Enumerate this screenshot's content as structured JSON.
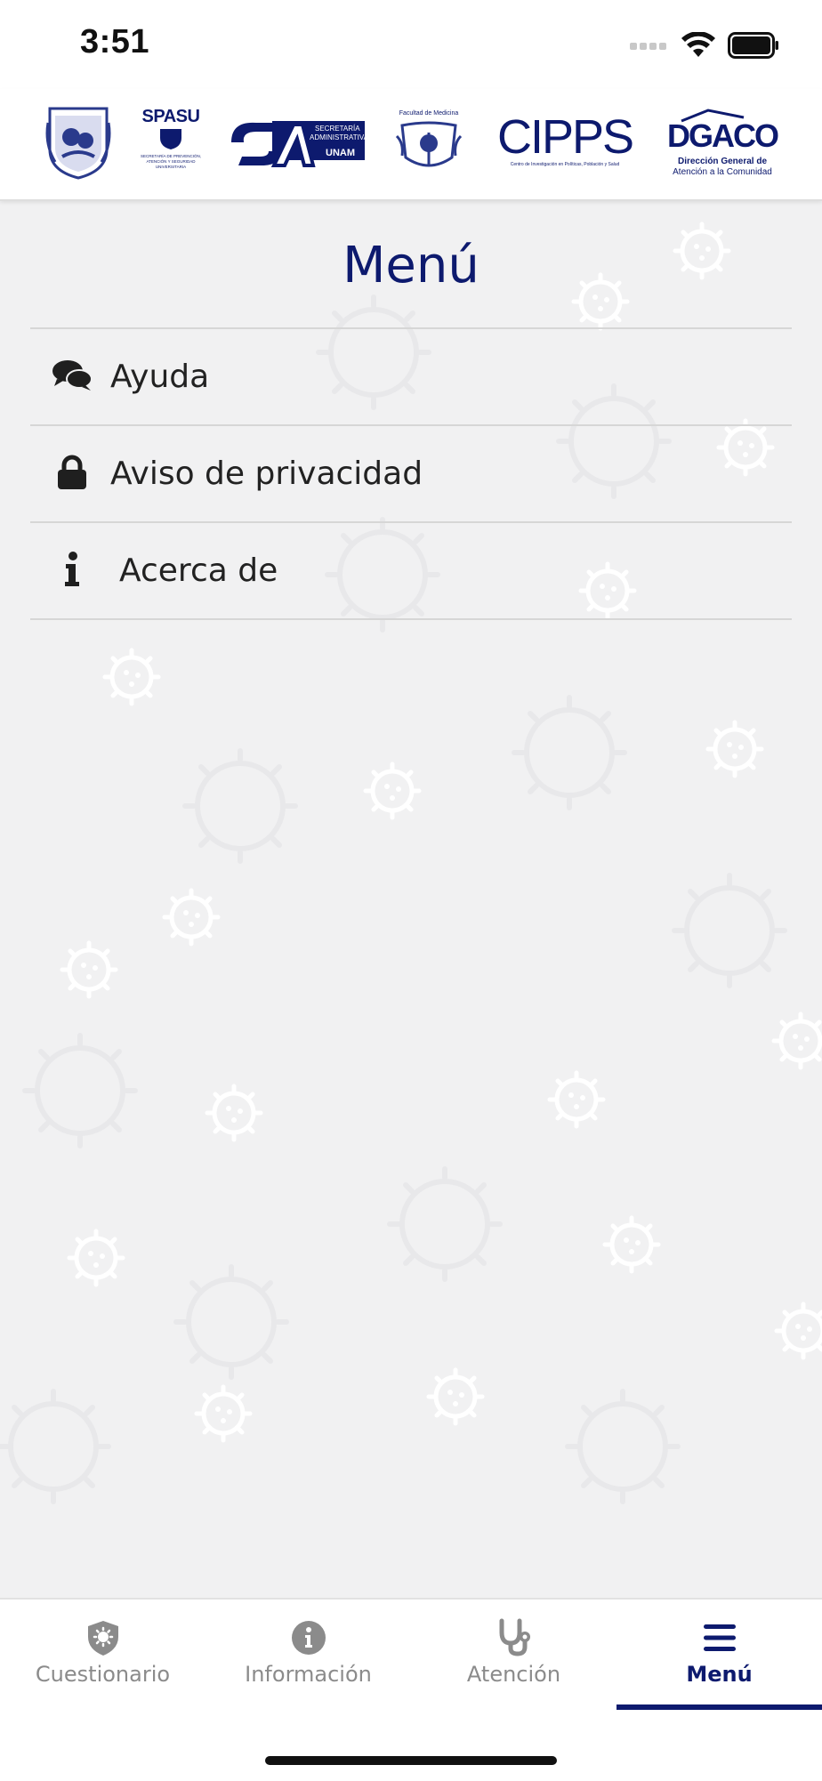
{
  "status_bar": {
    "time": "3:51"
  },
  "logos": [
    {
      "name": "unam-seal",
      "text": ""
    },
    {
      "name": "spasu-logo",
      "text": "SPASU",
      "subtext": "SECRETARÍA DE PREVENCIÓN, ATENCIÓN Y SEGURIDAD UNIVERSITARIA"
    },
    {
      "name": "secretaria-administrativa-logo",
      "text": "SA",
      "line1": "SECRETARÍA",
      "line2": "ADMINISTRATIVA",
      "line3": "UNAM"
    },
    {
      "name": "facultad-medicina-logo",
      "text": "Facultad de Medicina"
    },
    {
      "name": "cipps-logo",
      "text": "CIPPS",
      "subtext": "Centro de Investigación en Políticas, Población y Salud"
    },
    {
      "name": "dgaco-logo",
      "text": "DGACO",
      "line1": "Dirección General de",
      "line2": "Atención a la Comunidad"
    }
  ],
  "page": {
    "title": "Menú"
  },
  "menu": {
    "items": [
      {
        "label": "Ayuda",
        "icon": "chat-bubbles-icon"
      },
      {
        "label": "Aviso de privacidad",
        "icon": "lock-icon"
      },
      {
        "label": "Acerca de",
        "icon": "info-icon"
      }
    ]
  },
  "tabs": [
    {
      "label": "Cuestionario",
      "icon": "shield-virus-icon",
      "active": false
    },
    {
      "label": "Información",
      "icon": "info-circle-icon",
      "active": false
    },
    {
      "label": "Atención",
      "icon": "stethoscope-icon",
      "active": false
    },
    {
      "label": "Menú",
      "icon": "hamburger-icon",
      "active": true
    }
  ],
  "colors": {
    "primary": "#0d1a6e",
    "background": "#f1f1f2",
    "inactive": "#8b8b8b"
  }
}
